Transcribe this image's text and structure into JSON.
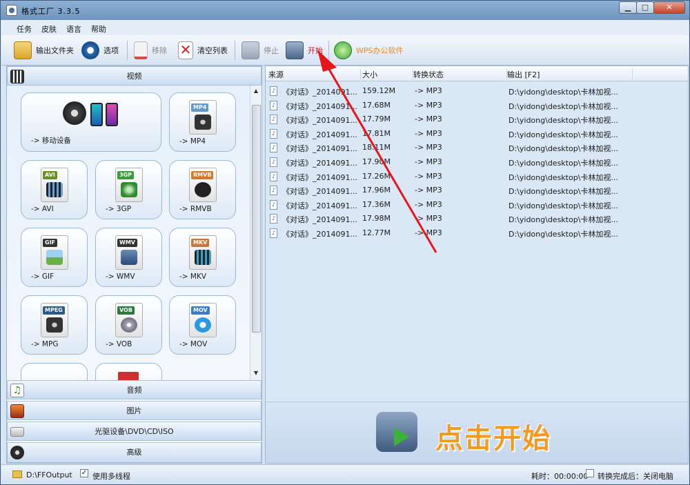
{
  "window": {
    "title": "格式工厂 3.3.5",
    "min": "▁",
    "max": "□",
    "close": "✕"
  },
  "menu": [
    "任务",
    "皮肤",
    "语言",
    "帮助"
  ],
  "toolbar": {
    "output_folder": "输出文件夹",
    "options": "选项",
    "remove": "移除",
    "clear_list": "清空列表",
    "stop": "停止",
    "start": "开始",
    "wps": "WPS办公软件"
  },
  "left": {
    "video_header": "视频",
    "tiles": [
      {
        "label": "-> 移动设备",
        "tag": ""
      },
      {
        "label": "-> MP4",
        "tag": "MP4"
      },
      {
        "label": "-> AVI",
        "tag": "AVI"
      },
      {
        "label": "-> 3GP",
        "tag": "3GP"
      },
      {
        "label": "-> RMVB",
        "tag": "RMVB"
      },
      {
        "label": "-> GIF",
        "tag": "GIF"
      },
      {
        "label": "-> WMV",
        "tag": "WMV"
      },
      {
        "label": "-> MKV",
        "tag": "MKV"
      },
      {
        "label": "-> MPG",
        "tag": "MPEG"
      },
      {
        "label": "-> VOB",
        "tag": "VOB"
      },
      {
        "label": "-> MOV",
        "tag": "MOV"
      }
    ],
    "audio_header": "音频",
    "picture_header": "图片",
    "disc_header": "光驱设备\\DVD\\CD\\ISO",
    "advanced_header": "高级"
  },
  "table": {
    "headers": [
      "来源",
      "大小",
      "转换状态",
      "输出 [F2]"
    ],
    "rows": [
      {
        "source": "《对话》_2014091...",
        "size": "159.12M",
        "status": "-> MP3",
        "output": "D:\\yidong\\desktop\\卡林加视..."
      },
      {
        "source": "《对话》_2014091...",
        "size": "17.68M",
        "status": "-> MP3",
        "output": "D:\\yidong\\desktop\\卡林加视..."
      },
      {
        "source": "《对话》_2014091...",
        "size": "17.79M",
        "status": "-> MP3",
        "output": "D:\\yidong\\desktop\\卡林加视..."
      },
      {
        "source": "《对话》_2014091...",
        "size": "17.81M",
        "status": "-> MP3",
        "output": "D:\\yidong\\desktop\\卡林加视..."
      },
      {
        "source": "《对话》_2014091...",
        "size": "18.11M",
        "status": "-> MP3",
        "output": "D:\\yidong\\desktop\\卡林加视..."
      },
      {
        "source": "《对话》_2014091...",
        "size": "17.90M",
        "status": "-> MP3",
        "output": "D:\\yidong\\desktop\\卡林加视..."
      },
      {
        "source": "《对话》_2014091...",
        "size": "17.26M",
        "status": "-> MP3",
        "output": "D:\\yidong\\desktop\\卡林加视..."
      },
      {
        "source": "《对话》_2014091...",
        "size": "17.96M",
        "status": "-> MP3",
        "output": "D:\\yidong\\desktop\\卡林加视..."
      },
      {
        "source": "《对话》_2014091...",
        "size": "17.36M",
        "status": "-> MP3",
        "output": "D:\\yidong\\desktop\\卡林加视..."
      },
      {
        "source": "《对话》_2014091...",
        "size": "17.98M",
        "status": "-> MP3",
        "output": "D:\\yidong\\desktop\\卡林加视..."
      },
      {
        "source": "《对话》_2014091...",
        "size": "12.77M",
        "status": "-> MP3",
        "output": "D:\\yidong\\desktop\\卡林加视..."
      }
    ]
  },
  "banner": {
    "text": "点击开始"
  },
  "status": {
    "output_path": "D:\\FFOutput",
    "multithread": "使用多线程",
    "elapsed": "耗时：00:00:00",
    "after_done": "转换完成后：关闭电脑"
  },
  "colors": {
    "accent": "#f59a1e",
    "arrow": "#e8141a"
  }
}
